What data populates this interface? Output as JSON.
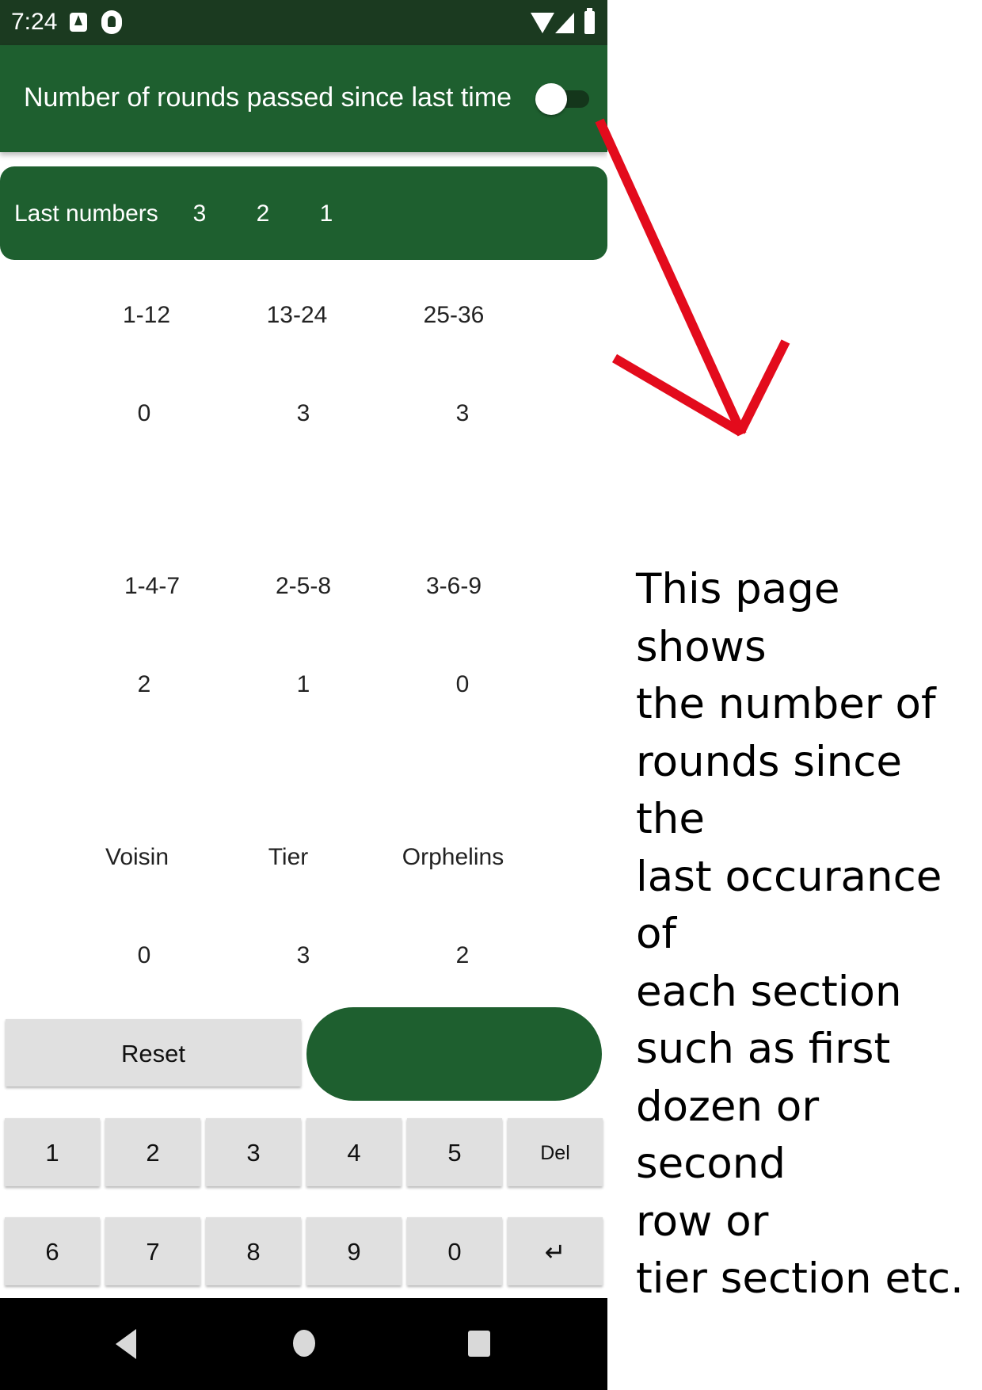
{
  "status_bar": {
    "time": "7:24"
  },
  "app_bar": {
    "title": "Number of rounds passed since last time",
    "toggle_on": false
  },
  "last_numbers": {
    "label": "Last numbers",
    "values": [
      "3",
      "2",
      "1"
    ]
  },
  "sections": [
    {
      "labels": [
        "1-12",
        "13-24",
        "25-36"
      ],
      "counts": [
        "0",
        "3",
        "3"
      ]
    },
    {
      "labels": [
        "1-4-7",
        "2-5-8",
        "3-6-9"
      ],
      "counts": [
        "2",
        "1",
        "0"
      ]
    },
    {
      "labels": [
        "Voisin",
        "Tier",
        "Orphelins"
      ],
      "counts": [
        "0",
        "3",
        "2"
      ]
    }
  ],
  "actions": {
    "reset_label": "Reset"
  },
  "keypad": {
    "row1": [
      "1",
      "2",
      "3",
      "4",
      "5",
      "Del"
    ],
    "row2": [
      "6",
      "7",
      "8",
      "9",
      "0",
      "↵"
    ]
  },
  "annotation": {
    "text": "This page shows\nthe number of\nrounds since the\nlast occurance of\neach section\nsuch as first\ndozen or second\nrow or\ntier section etc.",
    "arrow_color": "#e30b1c"
  },
  "colors": {
    "app_green": "#1e5f2f",
    "status_bar": "#1b3a20",
    "key_grey": "#e0e0e0"
  }
}
